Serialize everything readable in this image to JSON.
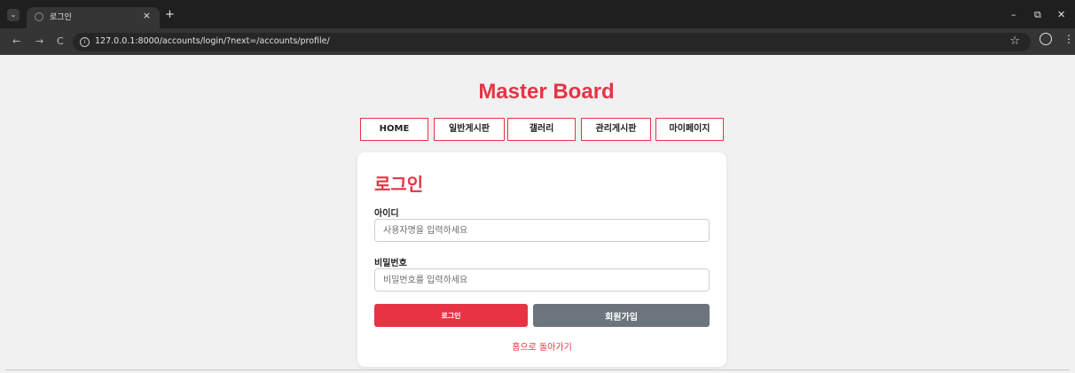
{
  "browser": {
    "tab_title": "로그인",
    "tab_close": "×",
    "new_tab": "+",
    "url": "127.0.0.1:8000/accounts/login/?next=/accounts/profile/",
    "controls": {
      "minimize": "–",
      "restore": "⧉",
      "close": "✕"
    },
    "nav": {
      "back": "←",
      "forward": "→",
      "reload": "C"
    }
  },
  "site": {
    "title": "Master Board",
    "nav": [
      "HOME",
      "일반게시판",
      "갤러리",
      "관리게시판",
      "마이페이지"
    ]
  },
  "login": {
    "heading": "로그인",
    "username_label": "아이디",
    "username_placeholder": "사용자명을 입력하세요",
    "password_label": "비밀번호",
    "password_placeholder": "비밀번호를 입력하세요",
    "login_button": "로그인",
    "signup_button": "회원가입",
    "back_home": "홈으로 돌아가기"
  },
  "colors": {
    "accent": "#e63445",
    "secondary_button": "#6c757d",
    "page_background": "#f1f1f1"
  },
  "icons": [
    "tab-list-icon",
    "site-favicon",
    "close-icon",
    "plus-icon",
    "back-arrow-icon",
    "forward-arrow-icon",
    "reload-icon",
    "site-info-icon",
    "star-icon",
    "profile-icon",
    "kebab-menu-icon"
  ]
}
